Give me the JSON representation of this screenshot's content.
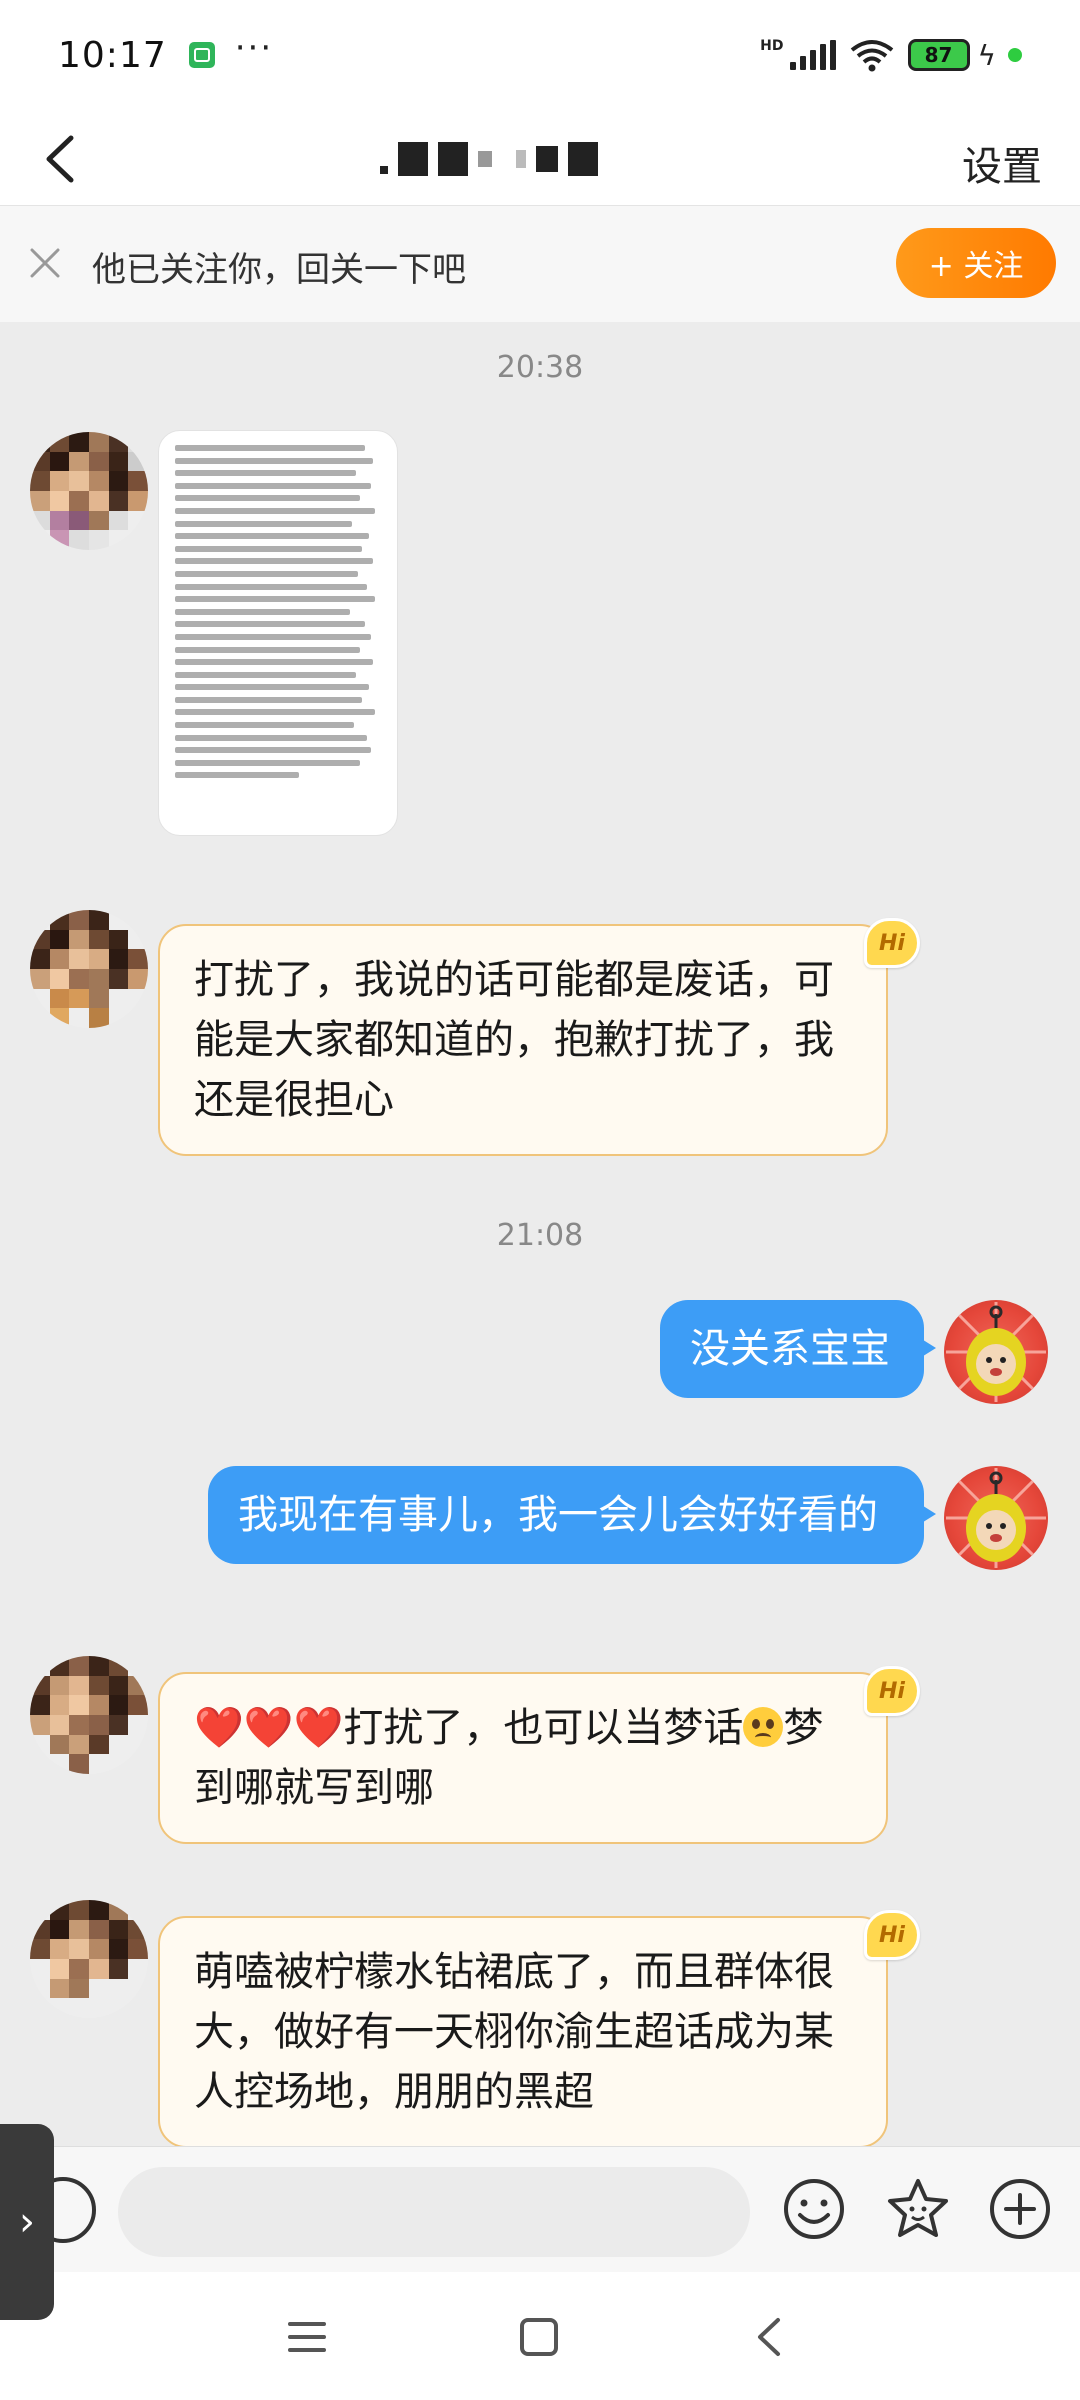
{
  "status_bar": {
    "time": "10:17",
    "more": "···",
    "network": "HD",
    "battery": "87"
  },
  "header": {
    "settings_label": "设置"
  },
  "follow_bar": {
    "text": "他已关注你，回关一下吧",
    "button_label": "+ 关注"
  },
  "messages": {
    "time_1": "20:38",
    "m2_text": "打扰了，我说的话可能都是废话，可能是大家都知道的，抱歉打扰了，我还是很担心",
    "time_2": "21:08",
    "m3_text": "没关系宝宝",
    "m4_text": "我现在有事儿，我一会儿会好好看的",
    "m5_hearts": "❤️❤️❤️",
    "m5_text": "打扰了，也可以当梦话",
    "m5_text_2": "梦到哪就写到哪",
    "m6_text": "萌嗑被柠檬水钻裙底了，而且群体很大，做好有一天栩你渝生超话成为某人控场地，朋朋的黑超",
    "hi_badge": "Hi"
  },
  "input": {
    "placeholder": ""
  },
  "colors": {
    "accent_orange": "#ff8a0d",
    "bubble_blue": "#3d9df6",
    "bubble_left_bg": "#fffaf1",
    "bubble_left_border": "#f0c47a"
  },
  "icons": {
    "back": "chevron-left-icon",
    "close": "close-icon",
    "voice": "voice-icon",
    "emoji": "emoji-icon",
    "sticker": "star-face-icon",
    "add": "plus-circle-icon"
  }
}
